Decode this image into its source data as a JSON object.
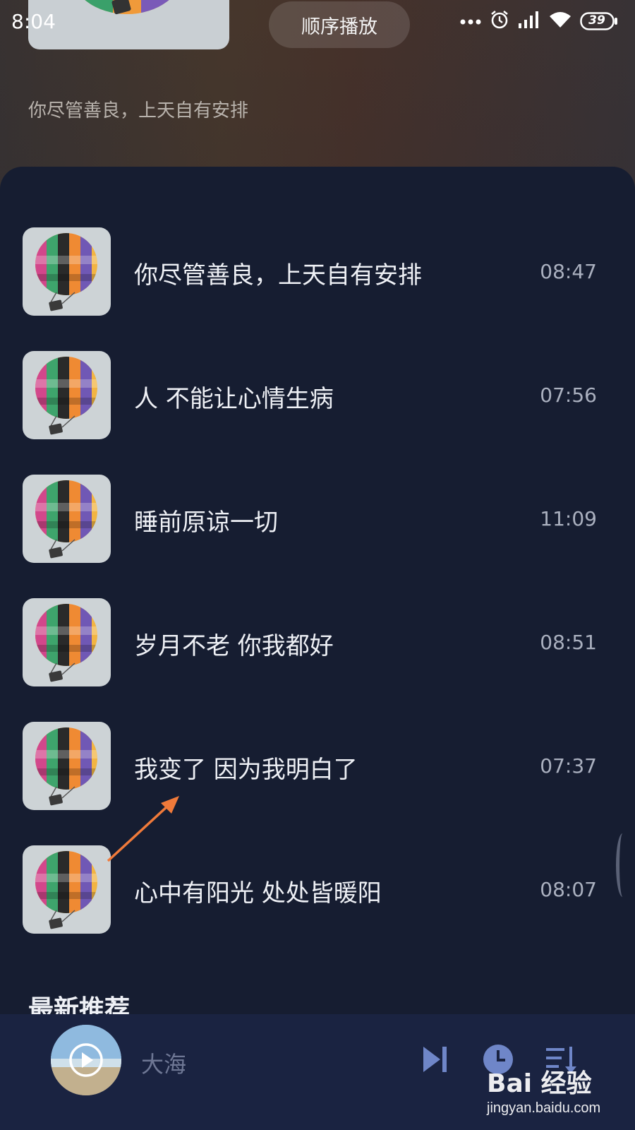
{
  "status_bar": {
    "time": "8:04",
    "battery": "39"
  },
  "header": {
    "play_mode": "顺序播放",
    "subtitle": "你尽管善良，上天自有安排"
  },
  "list": [
    {
      "title": "你尽管善良，上天自有安排",
      "time": "08:47"
    },
    {
      "title": "人 不能让心情生病",
      "time": "07:56"
    },
    {
      "title": "睡前原谅一切",
      "time": "11:09"
    },
    {
      "title": "岁月不老 你我都好",
      "time": "08:51"
    },
    {
      "title": "我变了 因为我明白了",
      "time": "07:37"
    },
    {
      "title": "心中有阳光 处处皆暖阳",
      "time": "08:07"
    }
  ],
  "section": {
    "title": "最新推荐"
  },
  "player": {
    "title": "大海"
  },
  "watermark": {
    "logo": "Bai 经验",
    "url": "jingyan.baidu.com"
  },
  "colors": {
    "sheet": "#161d31",
    "player": "#1a2341",
    "arrow": "#f07a3a"
  },
  "icons": [
    "signal-dots-icon",
    "alarm-icon",
    "cellular-signal-icon",
    "wifi-icon",
    "battery-icon",
    "play-icon",
    "skip-next-icon",
    "timer-icon",
    "playlist-icon"
  ]
}
